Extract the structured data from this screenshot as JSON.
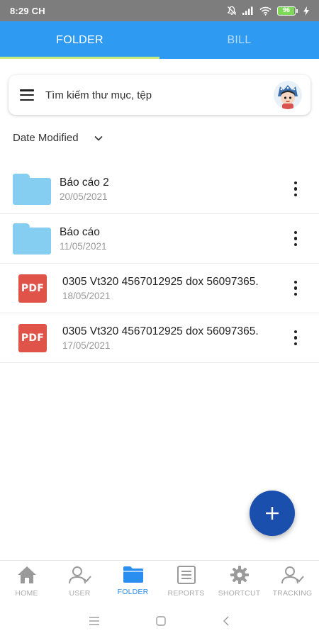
{
  "status_bar": {
    "time": "8:29 CH",
    "battery_level": "96",
    "battery_fraction": 0.96,
    "icons": [
      "mute-icon",
      "signal-icon",
      "wifi-icon",
      "battery-icon",
      "charging-icon"
    ]
  },
  "top_tabs": [
    {
      "label": "FOLDER",
      "active": true
    },
    {
      "label": "BILL",
      "active": false
    }
  ],
  "search": {
    "placeholder": "Tìm kiếm thư mục, tệp"
  },
  "sort": {
    "label": "Date Modified"
  },
  "files": [
    {
      "type": "folder",
      "name": "Báo cáo 2",
      "date": "20/05/2021"
    },
    {
      "type": "folder",
      "name": "Báo cáo",
      "date": "11/05/2021"
    },
    {
      "type": "pdf",
      "icon_text": "PDF",
      "name": "0305 Vt320 4567012925 dox 56097365.",
      "date": "18/05/2021"
    },
    {
      "type": "pdf",
      "icon_text": "PDF",
      "name": "0305 Vt320 4567012925 dox 56097365.",
      "date": "17/05/2021"
    }
  ],
  "bottom_nav": [
    {
      "label": "HOME",
      "icon": "home-icon",
      "active": false
    },
    {
      "label": "USER",
      "icon": "user-check-icon",
      "active": false
    },
    {
      "label": "FOLDER",
      "icon": "folder-icon",
      "active": true
    },
    {
      "label": "REPORTS",
      "icon": "reports-icon",
      "active": false
    },
    {
      "label": "SHORTCUT",
      "icon": "gear-icon",
      "active": false
    },
    {
      "label": "TRACKING",
      "icon": "user-check-icon",
      "active": false
    }
  ],
  "colors": {
    "primary": "#2f9af2",
    "tab_indicator": "#c6ec7e",
    "folder": "#86cdf2",
    "pdf": "#e05349",
    "fab": "#1b4fae",
    "nav_active": "#2a8ef0"
  }
}
